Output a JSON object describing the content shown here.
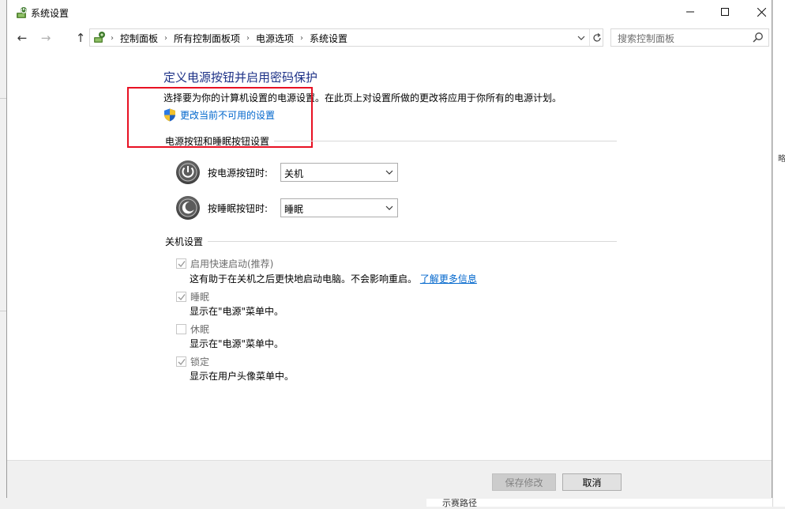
{
  "window": {
    "title": "系统设置"
  },
  "titlebar": {
    "minimize": "—",
    "maximize": "☐",
    "close": "✕"
  },
  "nav": {
    "back": "←",
    "forward": "→",
    "up": "↑",
    "breadcrumbs": [
      "控制面板",
      "所有控制面板项",
      "电源选项",
      "系统设置"
    ],
    "search_placeholder": "搜索控制面板"
  },
  "content": {
    "heading": "定义电源按钮并启用密码保护",
    "description": "选择要为你的计算机设置的电源设置。在此页上对设置所做的更改将应用于你所有的电源计划。",
    "uac_link": "更改当前不可用的设置",
    "power_group": {
      "title": "电源按钮和睡眠按钮设置",
      "power_button_label": "按电源按钮时:",
      "power_button_value": "关机",
      "sleep_button_label": "按睡眠按钮时:",
      "sleep_button_value": "睡眠"
    },
    "shutdown_group": {
      "title": "关机设置",
      "items": [
        {
          "label": "启用快速启动(推荐)",
          "desc": "这有助于在关机之后更快地启动电脑。不会影响重启。",
          "link": "了解更多信息",
          "checked": true
        },
        {
          "label": "睡眠",
          "desc": "显示在\"电源\"菜单中。",
          "checked": true
        },
        {
          "label": "休眠",
          "desc": "显示在\"电源\"菜单中。",
          "checked": false
        },
        {
          "label": "锁定",
          "desc": "显示在用户头像菜单中。",
          "checked": true
        }
      ]
    }
  },
  "footer": {
    "save_label": "保存修改",
    "cancel_label": "取消"
  },
  "colors": {
    "heading": "#1e3287",
    "link": "#0066cc",
    "highlight_box": "#e81123"
  }
}
